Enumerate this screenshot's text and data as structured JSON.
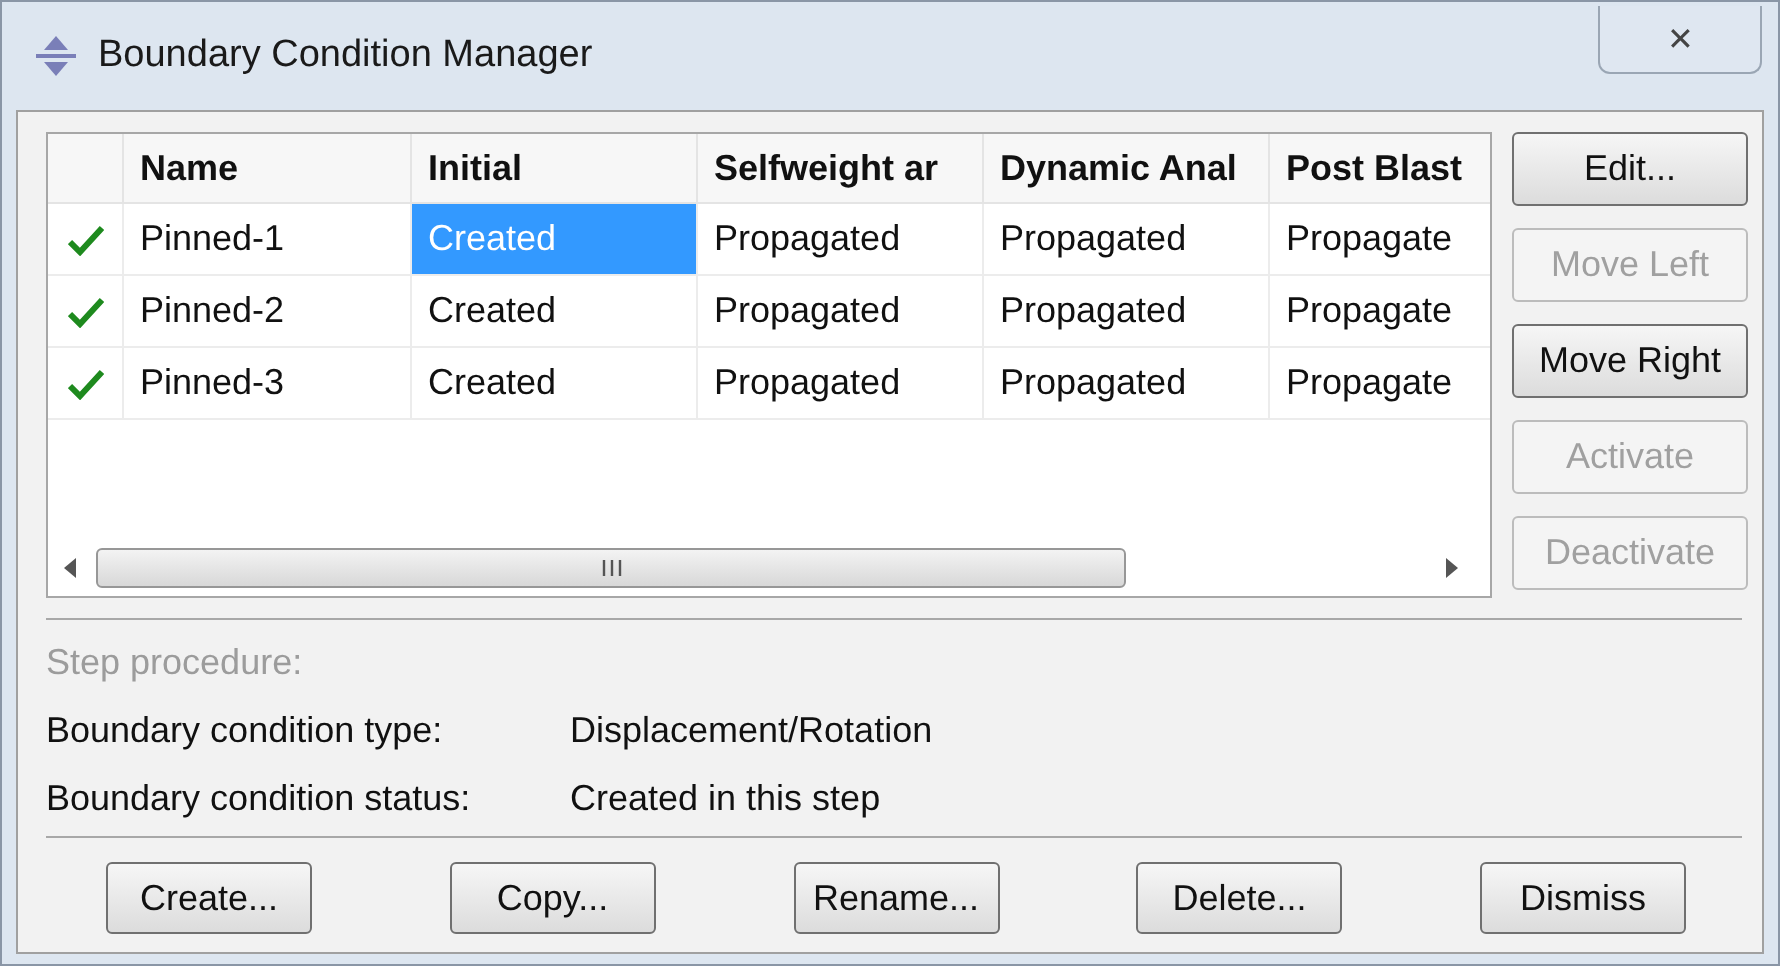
{
  "window": {
    "title": "Boundary Condition Manager",
    "close": "✕"
  },
  "table": {
    "columns": [
      "Name",
      "Initial",
      "Selfweight ar",
      "Dynamic Anal",
      "Post Blast"
    ],
    "rows": [
      {
        "active": true,
        "cells": [
          {
            "text": "Pinned-1",
            "selected": false
          },
          {
            "text": "Created",
            "selected": true
          },
          {
            "text": "Propagated",
            "selected": false
          },
          {
            "text": "Propagated",
            "selected": false
          },
          {
            "text": "Propagate",
            "selected": false
          }
        ]
      },
      {
        "active": true,
        "cells": [
          {
            "text": "Pinned-2",
            "selected": false
          },
          {
            "text": "Created",
            "selected": false
          },
          {
            "text": "Propagated",
            "selected": false
          },
          {
            "text": "Propagated",
            "selected": false
          },
          {
            "text": "Propagate",
            "selected": false
          }
        ]
      },
      {
        "active": true,
        "cells": [
          {
            "text": "Pinned-3",
            "selected": false
          },
          {
            "text": "Created",
            "selected": false
          },
          {
            "text": "Propagated",
            "selected": false
          },
          {
            "text": "Propagated",
            "selected": false
          },
          {
            "text": "Propagate",
            "selected": false
          }
        ]
      }
    ]
  },
  "side_buttons": [
    {
      "label": "Edit...",
      "disabled": false
    },
    {
      "label": "Move Left",
      "disabled": true
    },
    {
      "label": "Move Right",
      "disabled": false
    },
    {
      "label": "Activate",
      "disabled": true
    },
    {
      "label": "Deactivate",
      "disabled": true
    }
  ],
  "info": [
    {
      "label": "Step procedure:",
      "disabled": true
    },
    {
      "label": "Boundary condition type:",
      "value": "Displacement/Rotation",
      "disabled": false
    },
    {
      "label": "Boundary condition status:",
      "value": "Created in this step",
      "disabled": false
    }
  ],
  "buttons": [
    "Create...",
    "Copy...",
    "Rename...",
    "Delete...",
    "Dismiss"
  ]
}
